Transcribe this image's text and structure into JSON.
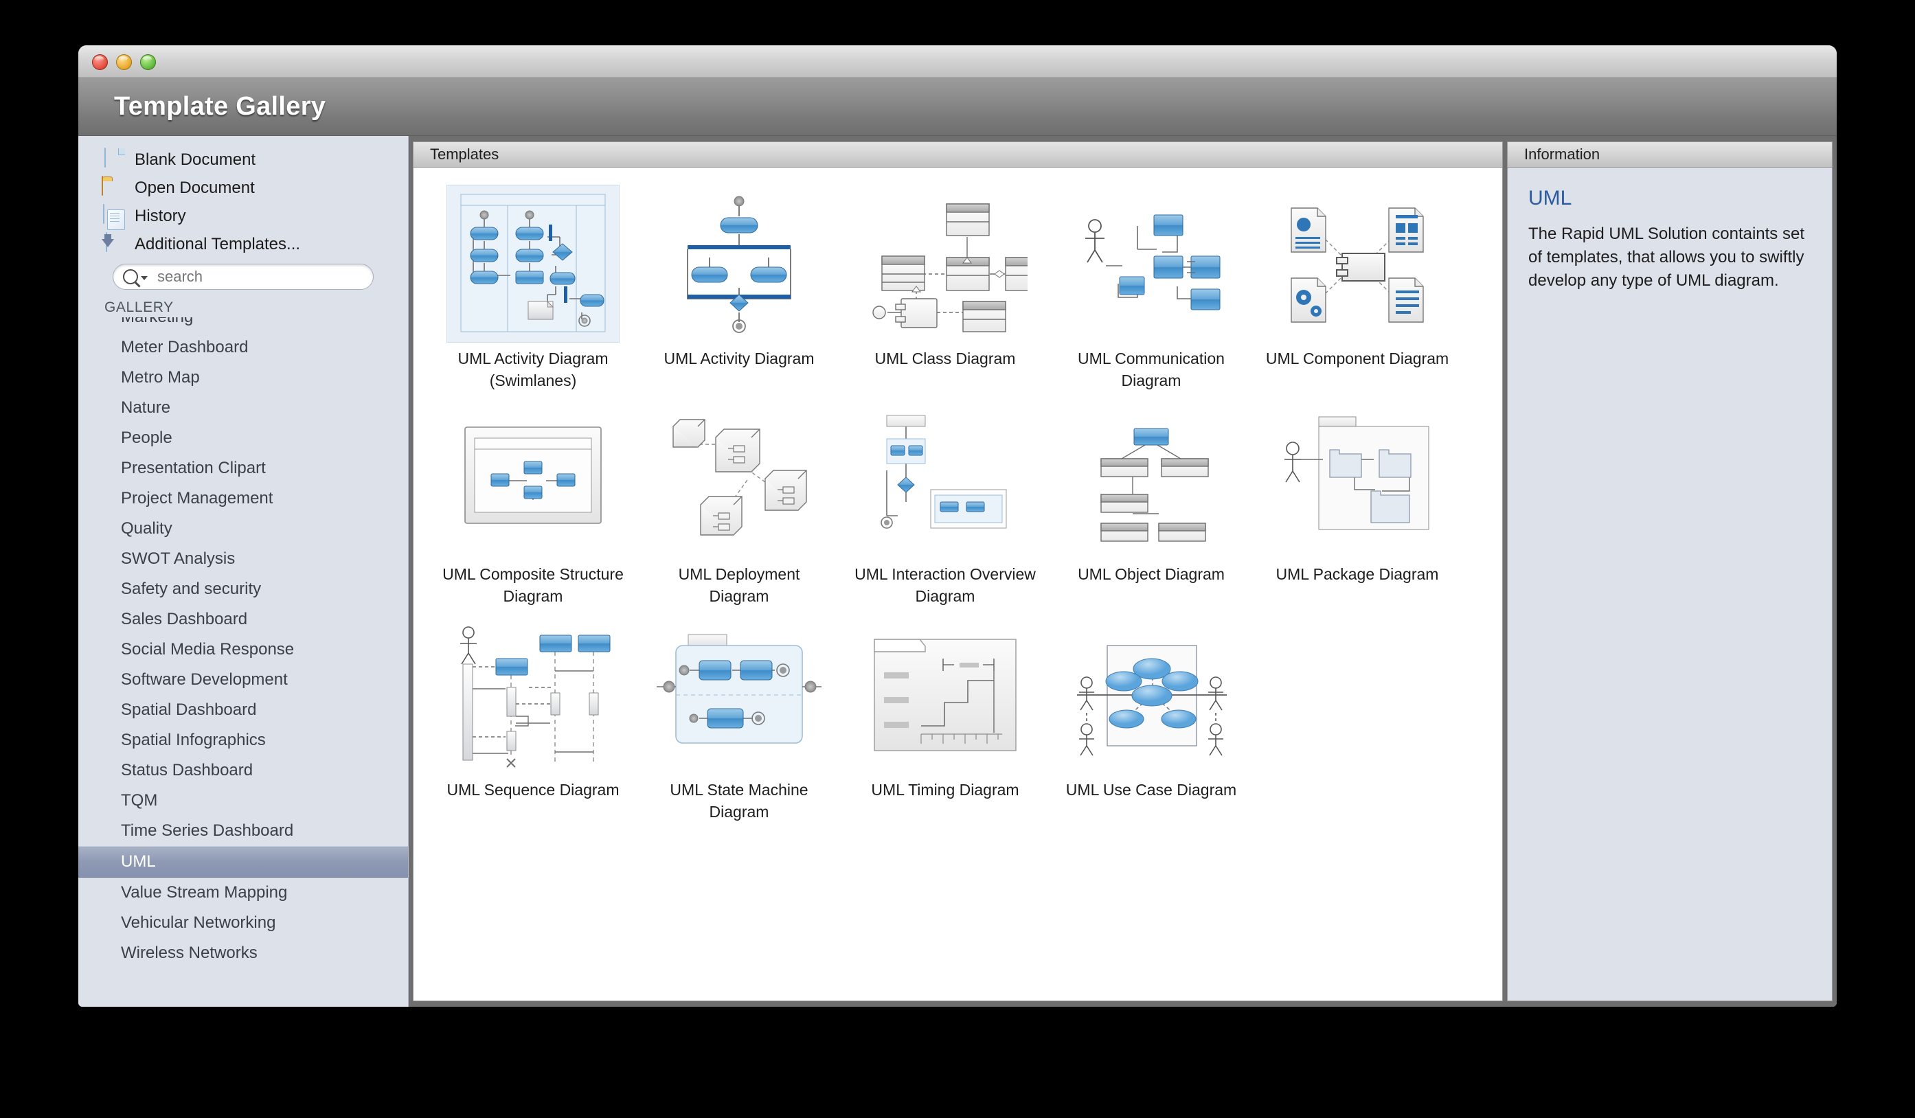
{
  "window": {
    "title": "Template Gallery",
    "controls": [
      "close-button",
      "minimize-button",
      "zoom-button"
    ]
  },
  "sidebar": {
    "shortcuts": [
      {
        "label": "Blank Document",
        "icon": "document-icon"
      },
      {
        "label": "Open Document",
        "icon": "folder-icon"
      },
      {
        "label": "History",
        "icon": "history-icon"
      },
      {
        "label": "Additional Templates...",
        "icon": "download-templates-icon"
      }
    ],
    "search": {
      "value": "",
      "placeholder": "search",
      "icon": "search-icon"
    },
    "gallery_header": "GALLERY",
    "items": [
      {
        "label": "Marketing",
        "selected": false,
        "clipped": true
      },
      {
        "label": "Meter Dashboard",
        "selected": false
      },
      {
        "label": "Metro Map",
        "selected": false
      },
      {
        "label": "Nature",
        "selected": false
      },
      {
        "label": "People",
        "selected": false
      },
      {
        "label": "Presentation Clipart",
        "selected": false
      },
      {
        "label": "Project Management",
        "selected": false
      },
      {
        "label": "Quality",
        "selected": false
      },
      {
        "label": "SWOT Analysis",
        "selected": false
      },
      {
        "label": "Safety and security",
        "selected": false
      },
      {
        "label": "Sales Dashboard",
        "selected": false
      },
      {
        "label": "Social Media Response",
        "selected": false
      },
      {
        "label": "Software Development",
        "selected": false
      },
      {
        "label": "Spatial Dashboard",
        "selected": false
      },
      {
        "label": "Spatial Infographics",
        "selected": false
      },
      {
        "label": "Status Dashboard",
        "selected": false
      },
      {
        "label": "TQM",
        "selected": false
      },
      {
        "label": "Time Series Dashboard",
        "selected": false
      },
      {
        "label": "UML",
        "selected": true
      },
      {
        "label": "Value Stream Mapping",
        "selected": false
      },
      {
        "label": "Vehicular Networking",
        "selected": false
      },
      {
        "label": "Wireless Networks",
        "selected": false,
        "clipped": true
      }
    ]
  },
  "templates_panel": {
    "header": "Templates",
    "items": [
      {
        "label": "UML Activity Diagram (Swimlanes)",
        "thumb": "activity-swimlanes-thumb",
        "selected": true
      },
      {
        "label": "UML Activity Diagram",
        "thumb": "activity-thumb",
        "selected": false
      },
      {
        "label": "UML Class Diagram",
        "thumb": "class-thumb",
        "selected": false
      },
      {
        "label": "UML Communication Diagram",
        "thumb": "communication-thumb",
        "selected": false
      },
      {
        "label": "UML Component Diagram",
        "thumb": "component-thumb",
        "selected": false
      },
      {
        "label": "UML Composite Structure Diagram",
        "thumb": "composite-structure-thumb",
        "selected": false
      },
      {
        "label": "UML Deployment Diagram",
        "thumb": "deployment-thumb",
        "selected": false
      },
      {
        "label": "UML Interaction Overview Diagram",
        "thumb": "interaction-overview-thumb",
        "selected": false
      },
      {
        "label": "UML Object Diagram",
        "thumb": "object-thumb",
        "selected": false
      },
      {
        "label": "UML Package Diagram",
        "thumb": "package-thumb",
        "selected": false
      },
      {
        "label": "UML Sequence Diagram",
        "thumb": "sequence-thumb",
        "selected": false
      },
      {
        "label": "UML State Machine Diagram",
        "thumb": "state-machine-thumb",
        "selected": false
      },
      {
        "label": "UML Timing Diagram",
        "thumb": "timing-thumb",
        "selected": false
      },
      {
        "label": "UML Use Case Diagram",
        "thumb": "use-case-thumb",
        "selected": false
      }
    ]
  },
  "information_panel": {
    "header": "Information",
    "title": "UML",
    "body": "The Rapid UML Solution containts set of templates, that allows you to swiftly develop any type of UML diagram."
  },
  "colors": {
    "accent_blue": "#2c5aa0",
    "selection_blue": "#8e9ab4",
    "shape_blue": "#3f8fd0",
    "panel_bg": "#dde1e9",
    "chrome_gray": "#7a7a7a"
  }
}
